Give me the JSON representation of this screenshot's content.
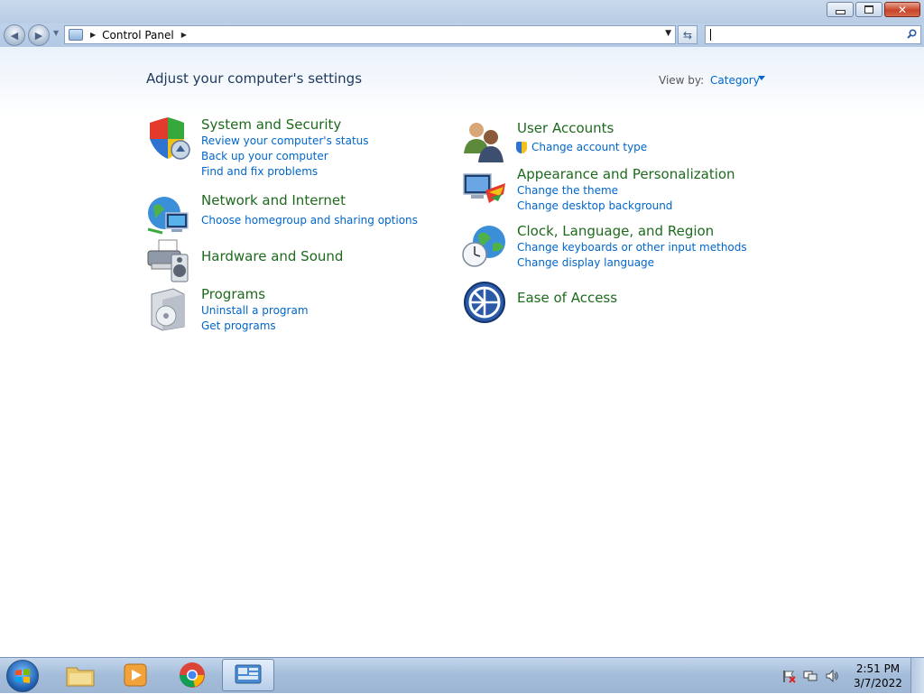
{
  "window": {
    "caption_buttons": [
      "minimize",
      "maximize",
      "close"
    ]
  },
  "nav": {
    "back_icon": "back-arrow-icon",
    "forward_icon": "forward-arrow-icon",
    "address": {
      "path": [
        "Control Panel"
      ]
    },
    "search": {
      "value": "",
      "placeholder": ""
    }
  },
  "header": {
    "title": "Adjust your computer's settings",
    "view_by_label": "View by:",
    "view_by_value": "Category"
  },
  "categories": {
    "system": {
      "title": "System and Security",
      "links": [
        "Review your computer's status",
        "Back up your computer",
        "Find and fix problems"
      ]
    },
    "network": {
      "title": "Network and Internet",
      "links": [
        "Choose homegroup and sharing options"
      ]
    },
    "hardware": {
      "title": "Hardware and Sound",
      "links": []
    },
    "programs": {
      "title": "Programs",
      "links": [
        "Uninstall a program",
        "Get programs"
      ]
    },
    "users": {
      "title": "User Accounts",
      "links": [
        "Change account type"
      ]
    },
    "appearance": {
      "title": "Appearance and Personalization",
      "links": [
        "Change the theme",
        "Change desktop background"
      ]
    },
    "clock": {
      "title": "Clock, Language, and Region",
      "links": [
        "Change keyboards or other input methods",
        "Change display language"
      ]
    },
    "ease": {
      "title": "Ease of Access",
      "links": []
    }
  },
  "taskbar": {
    "pinned": [
      "file-explorer-icon",
      "media-player-icon",
      "chrome-icon",
      "control-panel-icon"
    ],
    "active": "control-panel-icon",
    "tray_icons": [
      "action-center-flag-icon",
      "network-icon",
      "volume-icon"
    ],
    "time": "2:51 PM",
    "date": "3/7/2022"
  },
  "colors": {
    "category_title": "#1d6a1d",
    "link": "#0066cc",
    "heading": "#1e395b"
  }
}
